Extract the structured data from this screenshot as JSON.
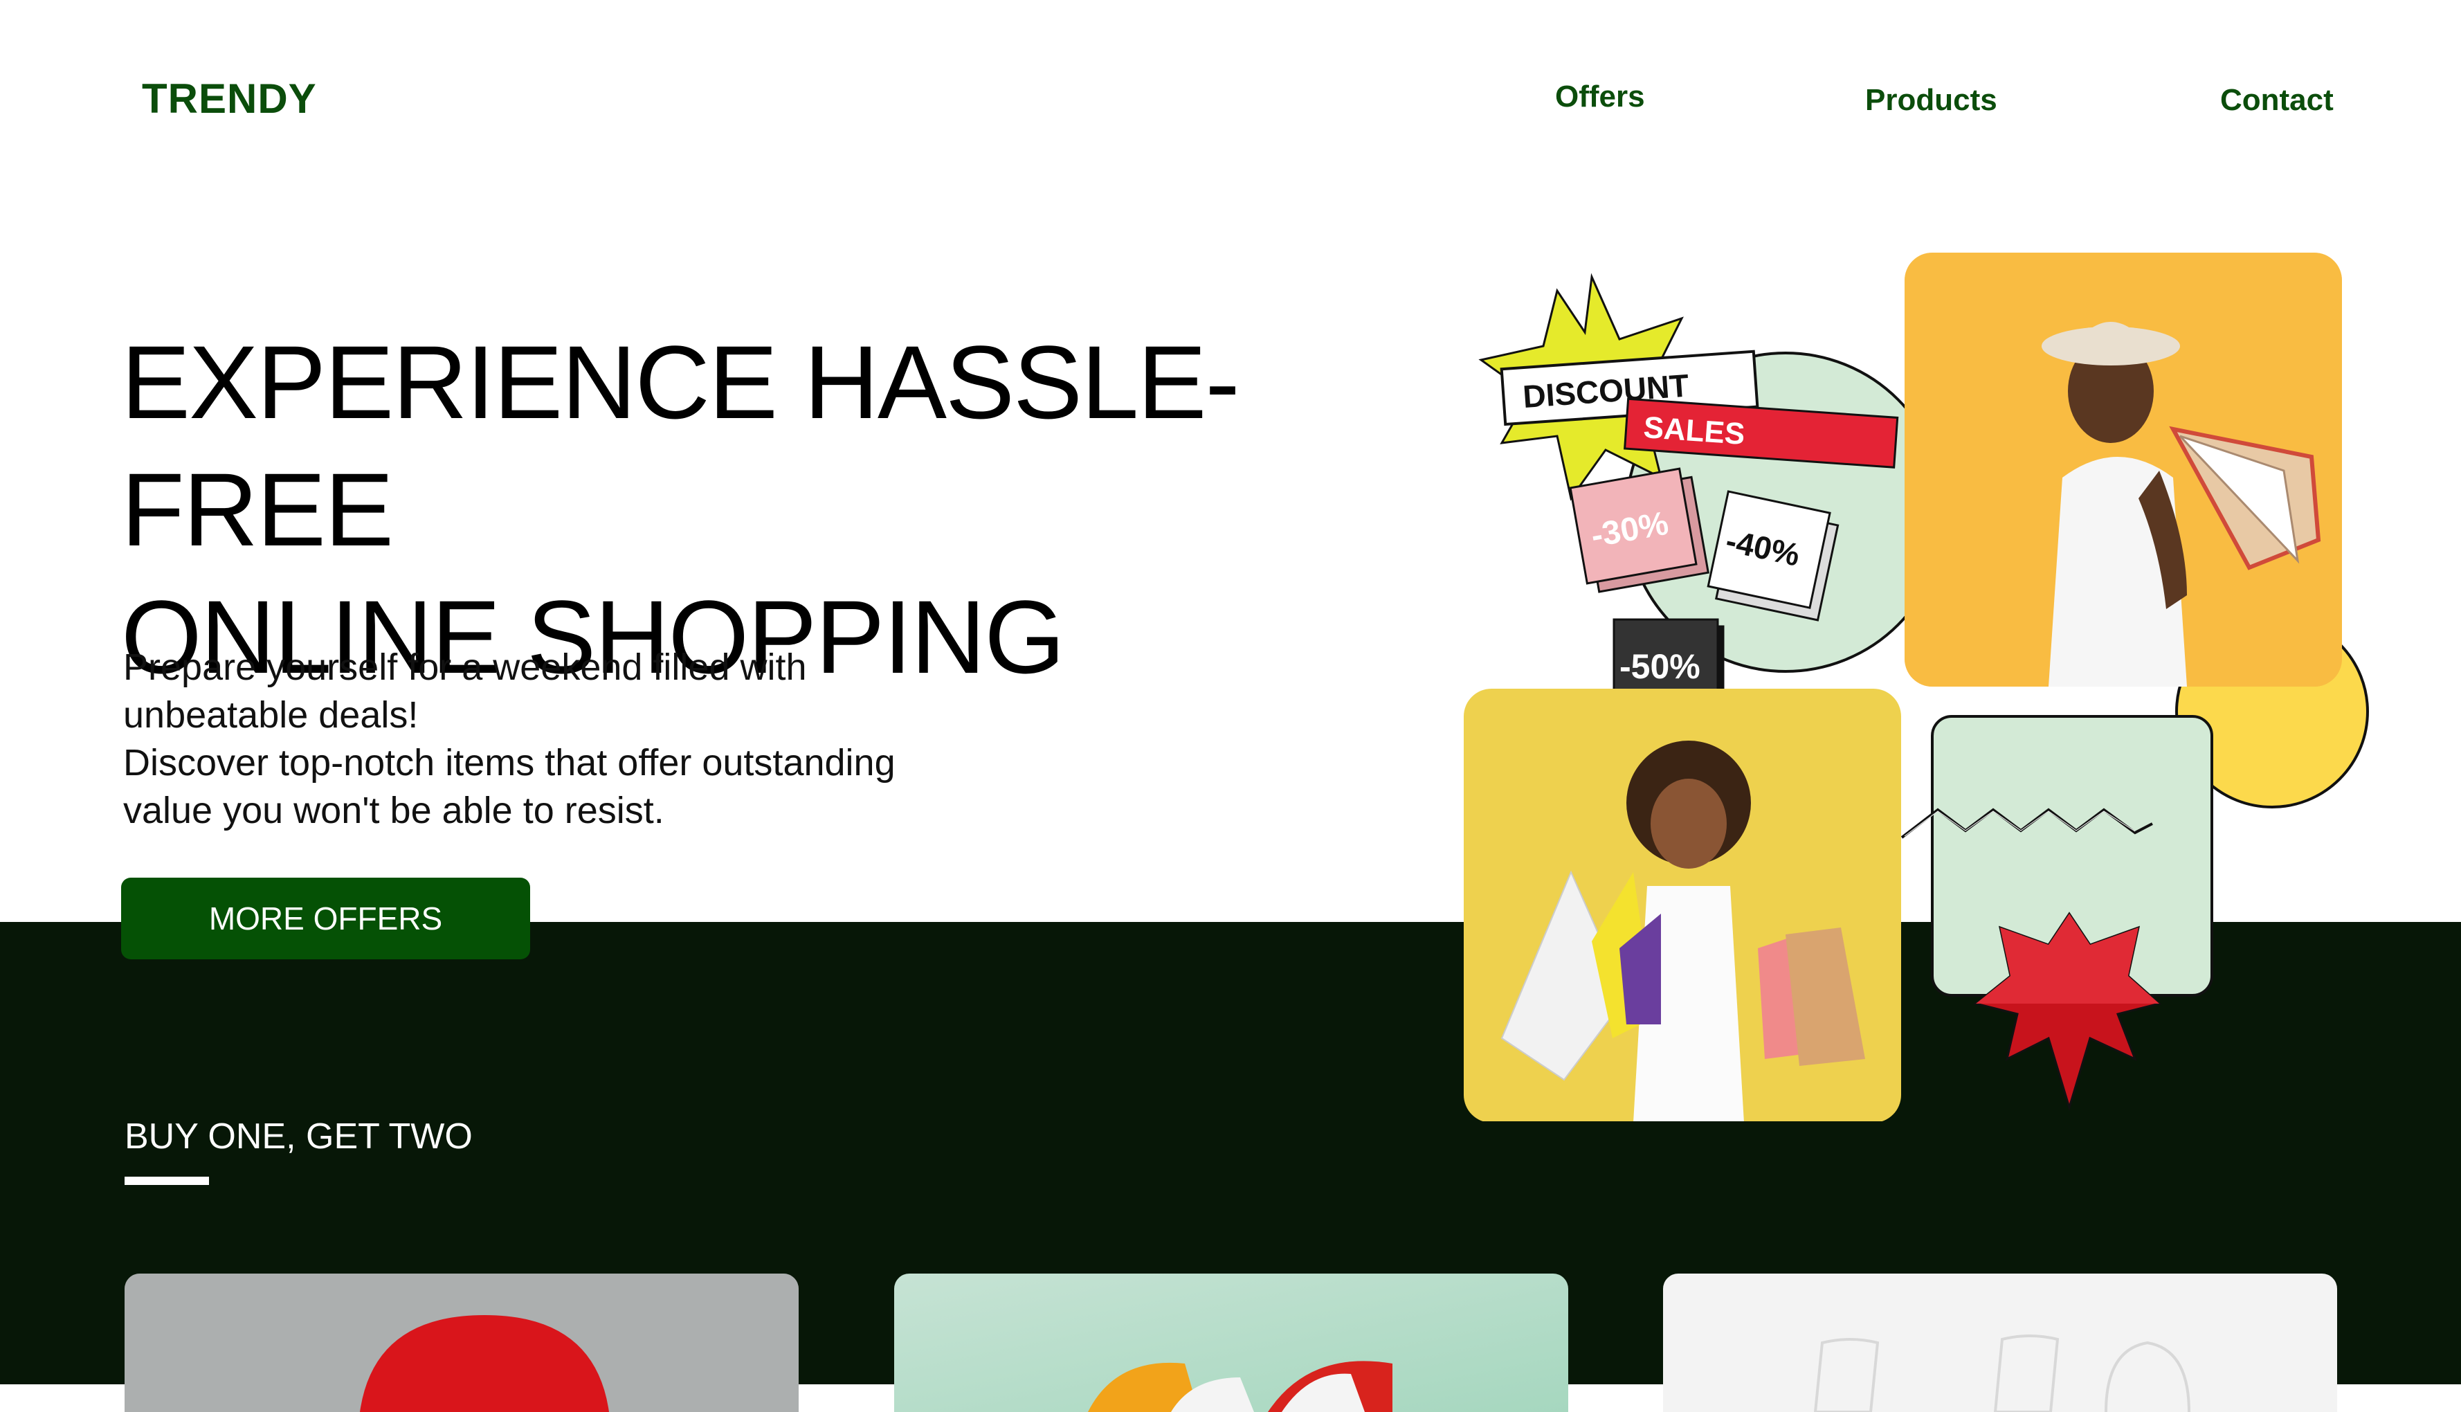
{
  "header": {
    "logo": "TRENDY",
    "nav": [
      "Offers",
      "Products",
      "Contact"
    ]
  },
  "hero": {
    "title_lines": [
      "EXPERIENCE HASSLE-FREE",
      "ONLINE SHOPPING"
    ],
    "description_lines": [
      "Prepare yourself for a weekend filled with",
      "unbeatable deals!",
      "Discover top-notch items that offer outstanding",
      "value you won't be able to resist."
    ],
    "cta_label": "MORE OFFERS"
  },
  "collage": {
    "discount_label": "DISCOUNT",
    "sales_label": "SALES",
    "tags": [
      "-30%",
      "-40%",
      "-50%"
    ]
  },
  "section": {
    "title": "BUY ONE, GET TWO"
  },
  "colors": {
    "brand_green": "#0b4d0b",
    "cta_green": "#055105",
    "dark_band": "#071707",
    "mint": "#d3ead6",
    "yellow_circle": "#fcd94c",
    "red_star": "#c8131c"
  }
}
